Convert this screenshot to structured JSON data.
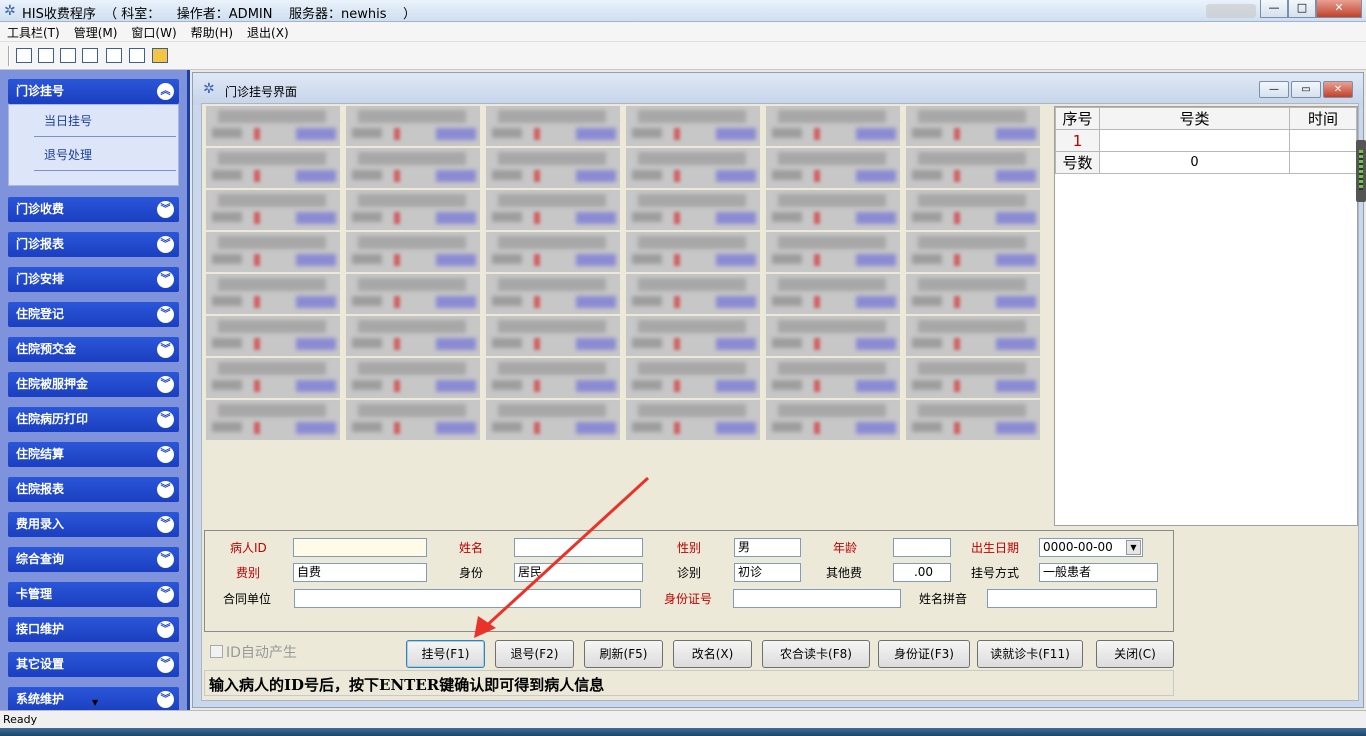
{
  "window": {
    "title": "HIS收费程序  （ 科室：    操作者：ADMIN    服务器：newhis    ）",
    "buttons": [
      "—",
      "□",
      "✕"
    ]
  },
  "menubar": [
    "工具栏(T)",
    "管理(M)",
    "窗口(W)",
    "帮助(H)",
    "退出(X)"
  ],
  "sidebar": {
    "expanded": {
      "label": "门诊挂号",
      "links": [
        "当日挂号",
        "退号处理"
      ]
    },
    "groups": [
      "门诊收费",
      "门诊报表",
      "门诊安排",
      "住院登记",
      "住院预交金",
      "住院被服押金",
      "住院病历打印",
      "住院结算",
      "住院报表",
      "费用录入",
      "综合查询",
      "卡管理",
      "接口维护",
      "其它设置",
      "系统维护"
    ]
  },
  "child_window": {
    "title": "门诊挂号界面"
  },
  "table": {
    "headers": [
      "序号",
      "号类",
      "时间"
    ],
    "rows": [
      [
        "1",
        "",
        ""
      ],
      [
        "号数",
        "0",
        ""
      ]
    ]
  },
  "form": {
    "patient_id_label": "病人ID",
    "patient_id_value": "",
    "name_label": "姓名",
    "name_value": "",
    "sex_label": "性别",
    "sex_value": "男",
    "age_label": "年龄",
    "age_value": "",
    "birth_label": "出生日期",
    "birth_value": "0000-00-00",
    "feetype_label": "费别",
    "feetype_value": "自费",
    "identity_label": "身份",
    "identity_value": "居民",
    "diag_label": "诊别",
    "diag_value": "初诊",
    "other_fee_label": "其他费",
    "other_fee_value": ".00",
    "reg_method_label": "挂号方式",
    "reg_method_value": "一般患者",
    "contract_label": "合同单位",
    "contract_value": "",
    "idcard_label": "身份证号",
    "idcard_value": "",
    "pinyin_label": "姓名拼音",
    "pinyin_value": ""
  },
  "auto_id_label": "ID自动产生",
  "buttons": {
    "register": "挂号(F1)",
    "unregister": "退号(F2)",
    "refresh": "刷新(F5)",
    "rename": "改名(X)",
    "nonghe": "农合读卡(F8)",
    "idcard": "身份证(F3)",
    "readcard": "读就诊卡(F11)",
    "close": "关闭(C)"
  },
  "hint": "输入病人的ID号后，按下ENTER键确认即可得到病人信息",
  "status": "Ready",
  "colors": {
    "sidebar_header": "#1a3fc0",
    "sidebar_bg": "#7f93dc",
    "label_red": "#c00000",
    "annotation_arrow": "#e8322a"
  }
}
